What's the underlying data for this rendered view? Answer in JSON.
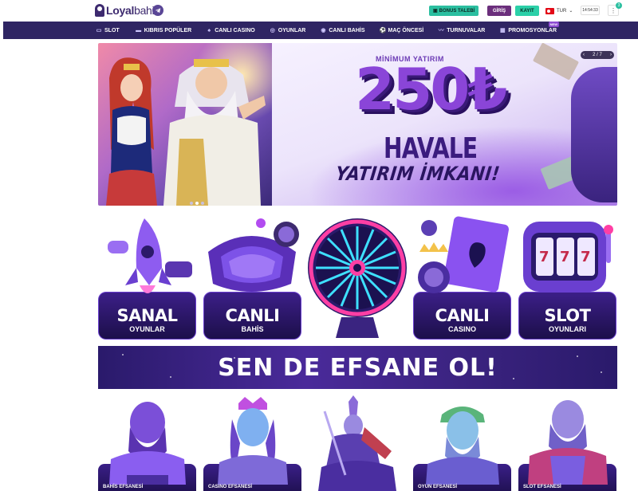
{
  "header": {
    "logo_main": "Loyal",
    "logo_accent": "bahis",
    "bonus_button": "BONUS TALEBİ",
    "login_button": "GİRİŞ",
    "register_button": "KAYIT",
    "language": "TUR",
    "clock": "14:54:33",
    "notification_count": "3"
  },
  "nav": {
    "items": [
      {
        "label": "SLOT",
        "icon": "slot-icon"
      },
      {
        "label": "KIBRIS POPÜLER",
        "icon": "popular-icon"
      },
      {
        "label": "CANLI CASINO",
        "icon": "casino-icon"
      },
      {
        "label": "OYUNLAR",
        "icon": "games-icon"
      },
      {
        "label": "CANLI BAHİS",
        "icon": "live-icon"
      },
      {
        "label": "MAÇ ÖNCESİ",
        "icon": "match-icon"
      },
      {
        "label": "TURNUVALAR",
        "icon": "tournament-icon"
      },
      {
        "label": "PROMOSYONLAR",
        "icon": "gift-icon",
        "badge": "NEW"
      }
    ]
  },
  "banner": {
    "min_text": "MİNİMUM YATIRIM",
    "amount": "250₺",
    "havale": "HAVALE",
    "yatirim": "YATIRIM İMKANI!",
    "slider_pos": "2 / 7"
  },
  "categories": [
    {
      "title": "SANAL",
      "sub": "OYUNLAR"
    },
    {
      "title": "CANLI",
      "sub": "BAHİS"
    },
    {
      "title": "",
      "sub": ""
    },
    {
      "title": "CANLI",
      "sub": "CASINO"
    },
    {
      "title": "SLOT",
      "sub": "OYUNLARI"
    }
  ],
  "legend_banner": {
    "text": "SEN DE EFSANE OL!"
  },
  "statues": [
    {
      "label": "BAHİS EFSANESİ"
    },
    {
      "label": "CASINO EFSANESİ"
    },
    {
      "label": ""
    },
    {
      "label": "OYUN EFSANESİ"
    },
    {
      "label": "SLOT EFSANESİ"
    }
  ],
  "colors": {
    "nav_bg": "#2f2563",
    "bonus_btn": "#2bbfa0",
    "login_btn": "#6b2f7c",
    "register_btn": "#2bd0a8",
    "card_bg": "#3c1f88"
  }
}
